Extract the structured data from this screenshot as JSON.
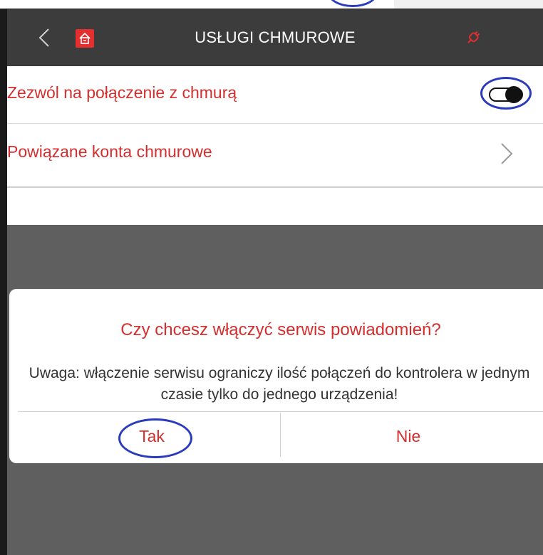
{
  "header": {
    "title": "USŁUGI CHMUROWE",
    "back_icon": "chevron-left-icon",
    "home_icon": "home-icon",
    "cloud_icon": "plug-icon"
  },
  "settings": {
    "allow_cloud": {
      "label": "Zezwól na połączenie z chmurą",
      "enabled": false
    },
    "linked_accounts": {
      "label": "Powiązane konta chmurowe"
    }
  },
  "dialog": {
    "question": "Czy chcesz włączyć serwis powiadomień?",
    "message": "Uwaga: włączenie serwisu ograniczy ilość połączeń do kontrolera w jednym czasie tylko do jednego urządzenia!",
    "yes_label": "Tak",
    "no_label": "Nie"
  },
  "colors": {
    "accent": "#d42e2e",
    "app_bar": "#3c3c3c",
    "overlay": "#5f5f5f",
    "annotation": "#2b3bbd"
  }
}
